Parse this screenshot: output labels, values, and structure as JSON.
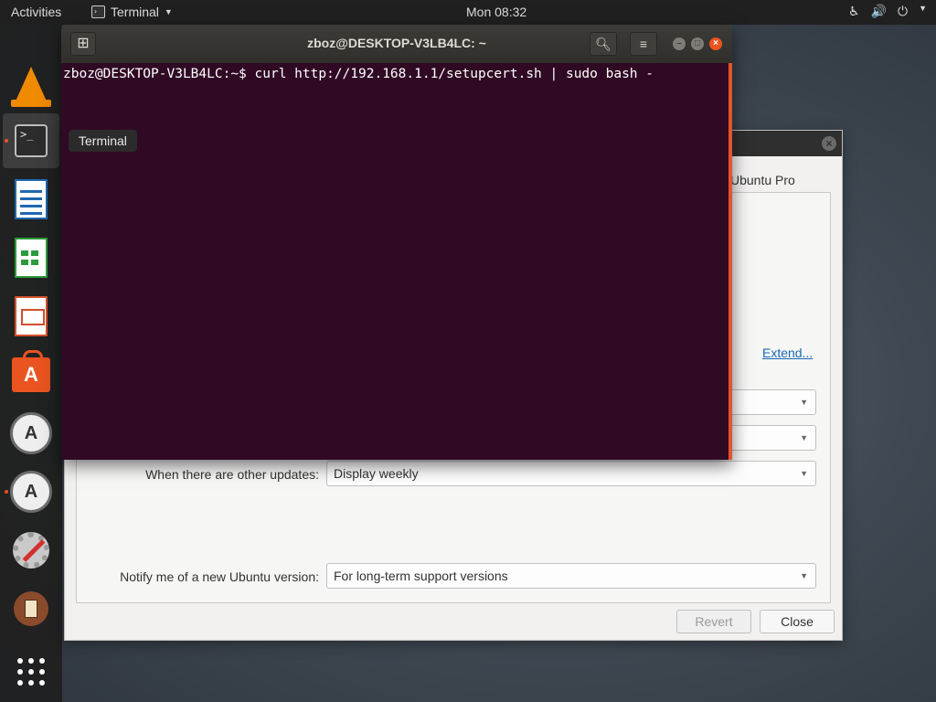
{
  "topbar": {
    "activities": "Activities",
    "app_name": "Terminal",
    "clock": "Mon 08:32"
  },
  "dock": {
    "tooltip": "Terminal",
    "items": [
      {
        "name": "vlc",
        "icon": "vlc-cone-icon"
      },
      {
        "name": "terminal",
        "icon": "terminal-icon"
      },
      {
        "name": "libreoffice-writer",
        "icon": "writer-icon"
      },
      {
        "name": "libreoffice-calc",
        "icon": "calc-icon"
      },
      {
        "name": "libreoffice-impress",
        "icon": "impress-icon"
      },
      {
        "name": "ubuntu-software",
        "icon": "software-bag-icon"
      },
      {
        "name": "software-updater",
        "icon": "update-icon"
      },
      {
        "name": "software-updater-2",
        "icon": "update-icon"
      },
      {
        "name": "system-settings",
        "icon": "settings-gear-icon"
      },
      {
        "name": "firmware",
        "icon": "firmware-icon"
      },
      {
        "name": "show-applications",
        "icon": "app-grid-icon"
      }
    ]
  },
  "terminal": {
    "title": "zboz@DESKTOP-V3LB4LC: ~",
    "command_line": "zboz@DESKTOP-V3LB4LC:~$ curl http://192.168.1.1/setupcert.sh | sudo bash -"
  },
  "dialog": {
    "tab_partial": "Ubuntu Pro",
    "extend_link": "Extend...",
    "other_updates_label": "When there are other updates:",
    "other_updates_value": "Display weekly",
    "notify_label": "Notify me of a new Ubuntu version:",
    "notify_value": "For long-term support versions",
    "revert_label": "Revert",
    "close_label": "Close"
  },
  "colors": {
    "terminal_bg": "#300a24",
    "accent": "#e95420",
    "topbar_bg": "#202020"
  }
}
